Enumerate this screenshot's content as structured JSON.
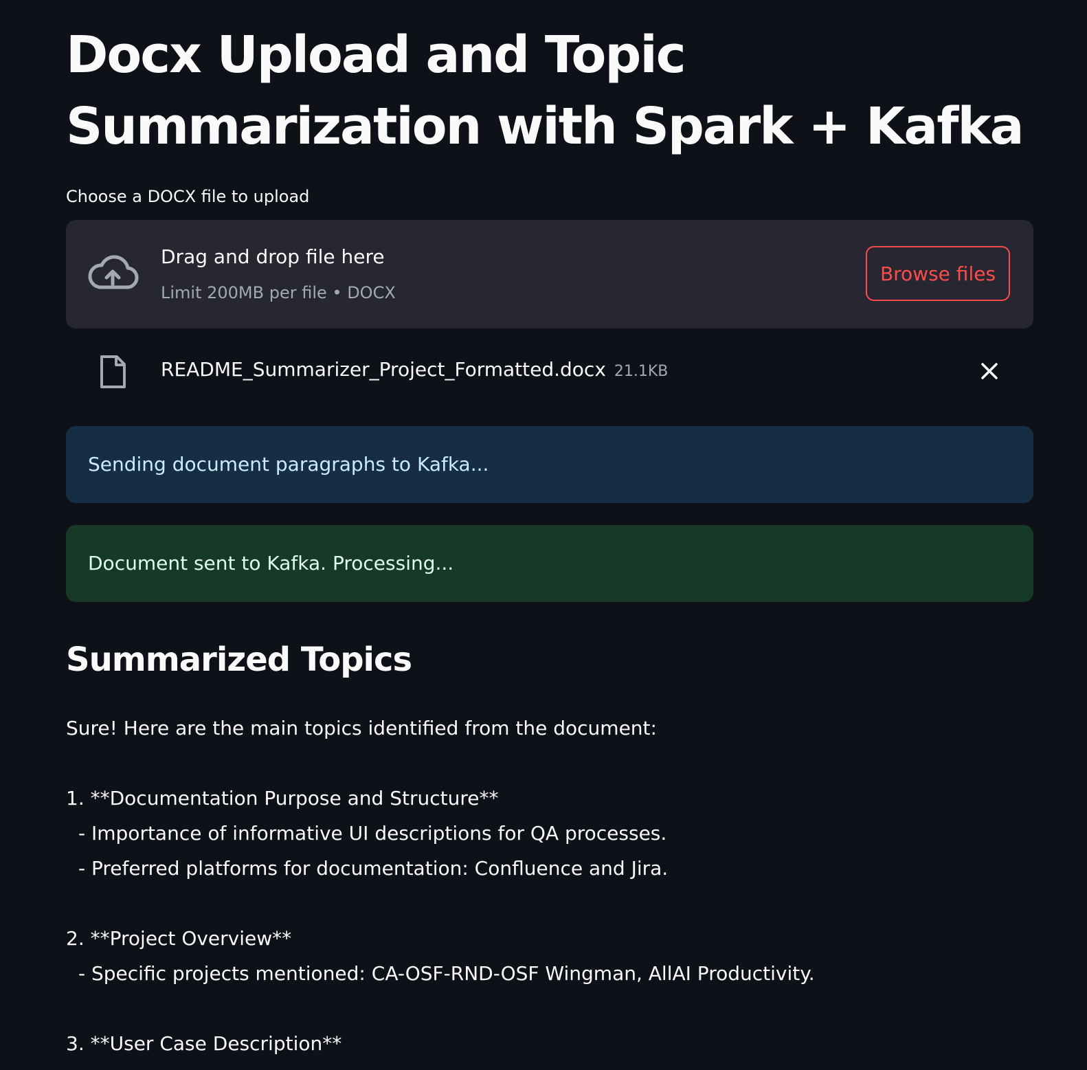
{
  "header": {
    "title": "Docx Upload and Topic Summarization with Spark + Kafka"
  },
  "uploader": {
    "label": "Choose a DOCX file to upload",
    "drop_title": "Drag and drop file here",
    "drop_subtitle": "Limit 200MB per file • DOCX",
    "browse_label": "Browse files",
    "icon": "cloud-upload-icon"
  },
  "uploaded_file": {
    "name": "README_Summarizer_Project_Formatted.docx",
    "size": "21.1KB",
    "icon": "file-icon",
    "remove_icon": "close-icon"
  },
  "alerts": {
    "info": "Sending document paragraphs to Kafka...",
    "success": "Document sent to Kafka. Processing..."
  },
  "summary": {
    "heading": "Summarized Topics",
    "lines": [
      "Sure! Here are the main topics identified from the document:",
      "",
      "1. **Documentation Purpose and Structure**",
      "- Importance of informative UI descriptions for QA processes.",
      "- Preferred platforms for documentation: Confluence and Jira.",
      "",
      "2. **Project Overview**",
      "- Specific projects mentioned: CA-OSF-RND-OSF Wingman, AllAI Productivity.",
      "",
      "3. **User Case Description**"
    ]
  },
  "colors": {
    "background": "#0e1117",
    "accent": "#ff4b4b",
    "info_bg": "#172d43",
    "success_bg": "#173928"
  }
}
